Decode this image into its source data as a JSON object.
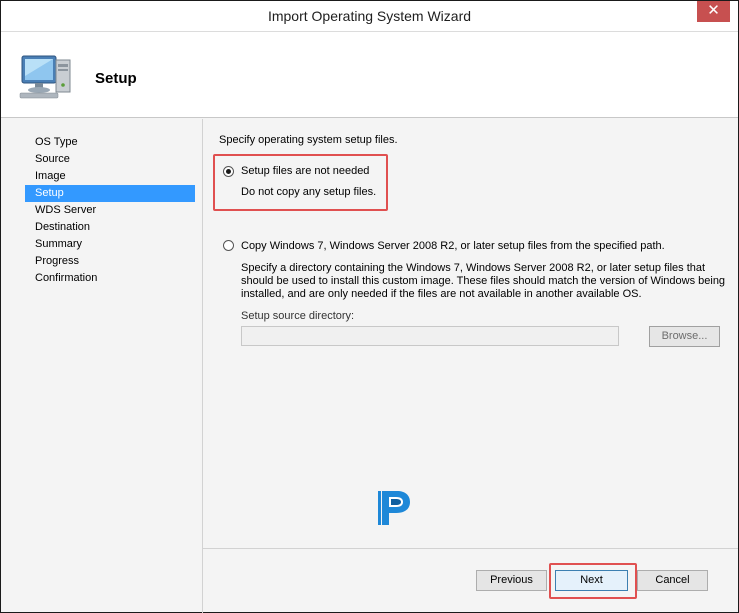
{
  "window": {
    "title": "Import Operating System Wizard",
    "close_glyph": "✕"
  },
  "header": {
    "title": "Setup",
    "icon": "computer-icon"
  },
  "nav": {
    "items": [
      {
        "label": "OS Type"
      },
      {
        "label": "Source"
      },
      {
        "label": "Image"
      },
      {
        "label": "Setup",
        "active": true
      },
      {
        "label": "WDS Server"
      },
      {
        "label": "Destination"
      },
      {
        "label": "Summary"
      },
      {
        "label": "Progress"
      },
      {
        "label": "Confirmation"
      }
    ]
  },
  "content": {
    "intro": "Specify operating system setup files.",
    "option1": {
      "label": "Setup files are not needed",
      "description": "Do not copy any setup files.",
      "selected": true
    },
    "option2": {
      "label": "Copy Windows 7, Windows Server 2008 R2, or later setup files from the specified path.",
      "description_line1": "Specify a directory containing the Windows 7, Windows Server 2008 R2, or later setup files that",
      "description_line2": "should be used to install this custom image.  These files should match the version of Windows being",
      "description_line3": "installed, and are only needed if the files are not available in another available OS.",
      "selected": false
    },
    "source_dir": {
      "label": "Setup source directory:",
      "value": ""
    },
    "browse_label": "Browse..."
  },
  "footer": {
    "previous_label": "Previous",
    "next_label": "Next",
    "cancel_label": "Cancel"
  },
  "colors": {
    "highlight": "#e05050",
    "nav_active": "#3399ff",
    "close_button": "#c75050"
  }
}
